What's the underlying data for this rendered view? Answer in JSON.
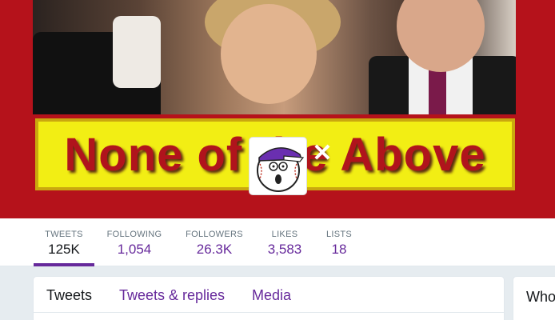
{
  "banner": {
    "sign_text": "None of the Above"
  },
  "avatar": {
    "alt": "baseball mascot avatar"
  },
  "close_label": "✕",
  "stats": [
    {
      "label": "TWEETS",
      "value": "125K",
      "active": true
    },
    {
      "label": "FOLLOWING",
      "value": "1,054"
    },
    {
      "label": "FOLLOWERS",
      "value": "26.3K"
    },
    {
      "label": "LIKES",
      "value": "3,583"
    },
    {
      "label": "LISTS",
      "value": "18"
    }
  ],
  "tabs": [
    {
      "label": "Tweets",
      "active": true
    },
    {
      "label": "Tweets & replies"
    },
    {
      "label": "Media"
    }
  ],
  "sidebar": {
    "who_to_follow": "Who"
  },
  "colors": {
    "banner_red": "#b5121b",
    "sign_yellow": "#f2ee14",
    "accent_purple": "#66299b"
  }
}
